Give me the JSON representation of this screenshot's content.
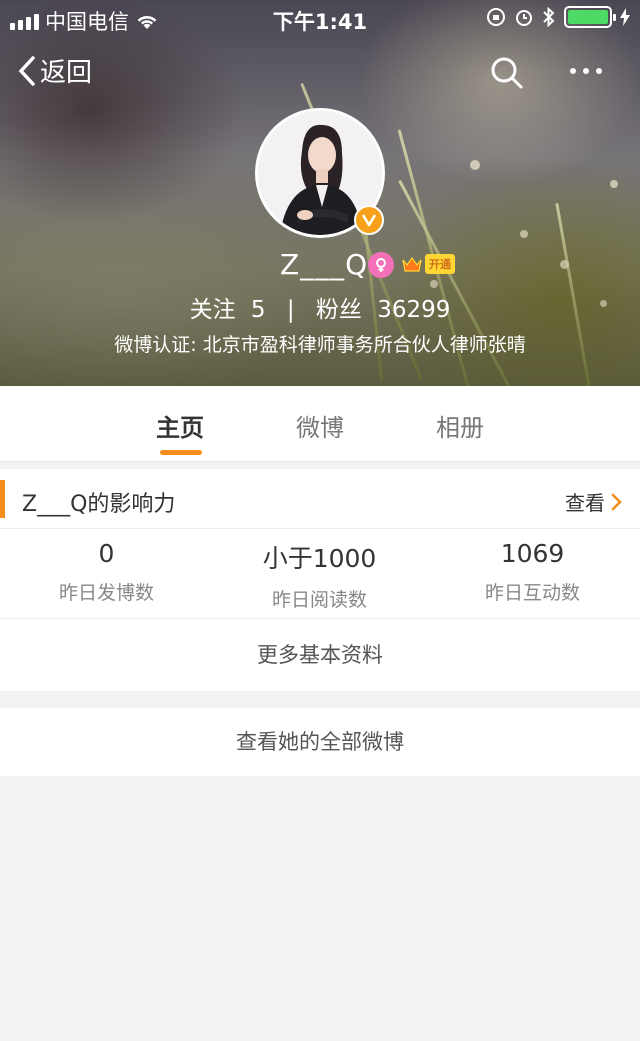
{
  "status_bar": {
    "carrier": "中国电信",
    "time": "下午1:41"
  },
  "nav": {
    "back_label": "返回",
    "icons": [
      "back-chevron-icon",
      "search-icon",
      "more-dots-icon"
    ]
  },
  "profile": {
    "name": "Z___Q",
    "vip_badge": "开通",
    "follow_label": "关注",
    "follow_count": "5",
    "fans_label": "粉丝",
    "fans_count": "36299",
    "certification": "微博认证: 北京市盈科律师事务所合伙人律师张晴"
  },
  "tabs": [
    {
      "label": "主页",
      "active": true
    },
    {
      "label": "微博",
      "active": false
    },
    {
      "label": "相册",
      "active": false
    }
  ],
  "influence": {
    "title": "Z___Q的影响力",
    "view_label": "查看",
    "stats": [
      {
        "value": "0",
        "label": "昨日发博数"
      },
      {
        "value": "小于1000",
        "label": "昨日阅读数"
      },
      {
        "value": "1069",
        "label": "昨日互动数"
      }
    ],
    "more_info_label": "更多基本资料"
  },
  "all_weibo_label": "查看她的全部微博",
  "colors": {
    "accent": "#f58d1b",
    "verified": "#f7a11b",
    "gender": "#f370b8",
    "battery": "#4cd964"
  }
}
